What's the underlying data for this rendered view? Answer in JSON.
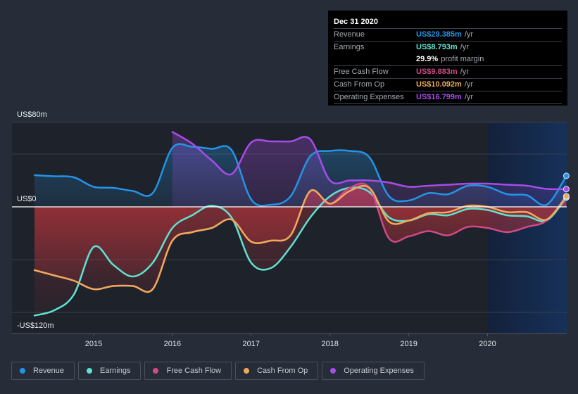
{
  "tooltip": {
    "date": "Dec 31 2020",
    "rows": [
      {
        "label": "Revenue",
        "value": "US$29.385m",
        "unit": "/yr",
        "color": "#2394e6"
      },
      {
        "label": "Earnings",
        "value": "US$8.793m",
        "unit": "/yr",
        "color": "#5ee3d0"
      },
      {
        "label": "",
        "value": "29.9%",
        "unit": "profit margin",
        "color": "#ffffff"
      },
      {
        "label": "Free Cash Flow",
        "value": "US$9.883m",
        "unit": "/yr",
        "color": "#d14987"
      },
      {
        "label": "Cash From Op",
        "value": "US$10.092m",
        "unit": "/yr",
        "color": "#eeaa5a"
      },
      {
        "label": "Operating Expenses",
        "value": "US$16.799m",
        "unit": "/yr",
        "color": "#a64de8"
      }
    ]
  },
  "legend": [
    {
      "label": "Revenue",
      "color": "#2394e6"
    },
    {
      "label": "Earnings",
      "color": "#5ee3d0"
    },
    {
      "label": "Free Cash Flow",
      "color": "#d14987"
    },
    {
      "label": "Cash From Op",
      "color": "#eeaa5a"
    },
    {
      "label": "Operating Expenses",
      "color": "#a64de8"
    }
  ],
  "chart_data": {
    "type": "line",
    "title": "",
    "xlabel": "",
    "ylabel": "",
    "ylim": [
      -120,
      80
    ],
    "y_unit": "US$m",
    "y_tick_labels": [
      {
        "value": 80,
        "label": "US$80m"
      },
      {
        "value": 0,
        "label": "US$0"
      },
      {
        "value": -120,
        "label": "-US$120m"
      }
    ],
    "gridlines": [
      80,
      50,
      0,
      -50,
      -100
    ],
    "x_range": [
      2014.25,
      2021.0
    ],
    "x_ticks": [
      2015,
      2016,
      2017,
      2018,
      2019,
      2020
    ],
    "forecast_start": 2020.0,
    "grid": true,
    "legend_position": "bottom-left",
    "series": [
      {
        "name": "Revenue",
        "color": "#2394e6",
        "points": [
          [
            2014.25,
            30
          ],
          [
            2014.5,
            29
          ],
          [
            2014.75,
            28
          ],
          [
            2015.0,
            19
          ],
          [
            2015.25,
            18
          ],
          [
            2015.5,
            15
          ],
          [
            2015.75,
            13
          ],
          [
            2016.0,
            56
          ],
          [
            2016.25,
            57
          ],
          [
            2016.5,
            55
          ],
          [
            2016.75,
            54
          ],
          [
            2017.0,
            7
          ],
          [
            2017.25,
            2
          ],
          [
            2017.5,
            10
          ],
          [
            2017.75,
            48
          ],
          [
            2018.0,
            53
          ],
          [
            2018.25,
            53
          ],
          [
            2018.5,
            47
          ],
          [
            2018.75,
            10
          ],
          [
            2019.0,
            6
          ],
          [
            2019.25,
            13
          ],
          [
            2019.5,
            12
          ],
          [
            2019.75,
            20
          ],
          [
            2020.0,
            19
          ],
          [
            2020.25,
            12
          ],
          [
            2020.5,
            11
          ],
          [
            2020.75,
            2
          ],
          [
            2021.0,
            29.385
          ]
        ]
      },
      {
        "name": "Earnings",
        "color": "#5ee3d0",
        "points": [
          [
            2014.25,
            -103
          ],
          [
            2014.5,
            -98
          ],
          [
            2014.75,
            -83
          ],
          [
            2015.0,
            -38
          ],
          [
            2015.25,
            -55
          ],
          [
            2015.5,
            -66
          ],
          [
            2015.75,
            -53
          ],
          [
            2016.0,
            -20
          ],
          [
            2016.25,
            -8
          ],
          [
            2016.5,
            1
          ],
          [
            2016.75,
            -10
          ],
          [
            2017.0,
            -53
          ],
          [
            2017.25,
            -58
          ],
          [
            2017.5,
            -38
          ],
          [
            2017.75,
            -10
          ],
          [
            2018.0,
            10
          ],
          [
            2018.25,
            18
          ],
          [
            2018.5,
            14
          ],
          [
            2018.75,
            -10
          ],
          [
            2019.0,
            -13
          ],
          [
            2019.25,
            -7
          ],
          [
            2019.5,
            -8
          ],
          [
            2019.75,
            -2
          ],
          [
            2020.0,
            -3
          ],
          [
            2020.25,
            -8
          ],
          [
            2020.5,
            -9
          ],
          [
            2020.75,
            -13
          ],
          [
            2021.0,
            8.793
          ]
        ]
      },
      {
        "name": "Free Cash Flow",
        "color": "#d14987",
        "points": [
          [
            2014.25,
            -60
          ],
          [
            2014.5,
            -65
          ],
          [
            2014.75,
            -70
          ],
          [
            2015.0,
            -78
          ],
          [
            2015.25,
            -75
          ],
          [
            2015.5,
            -75
          ],
          [
            2015.75,
            -78
          ],
          [
            2016.0,
            -32
          ],
          [
            2016.25,
            -24
          ],
          [
            2016.5,
            -20
          ],
          [
            2016.75,
            -12
          ],
          [
            2017.0,
            -33
          ],
          [
            2017.25,
            -32
          ],
          [
            2017.5,
            -27
          ],
          [
            2017.75,
            15
          ],
          [
            2018.0,
            3
          ],
          [
            2018.25,
            18
          ],
          [
            2018.5,
            18
          ],
          [
            2018.75,
            -30
          ],
          [
            2019.0,
            -28
          ],
          [
            2019.25,
            -23
          ],
          [
            2019.5,
            -27
          ],
          [
            2019.75,
            -19
          ],
          [
            2020.0,
            -20
          ],
          [
            2020.25,
            -24
          ],
          [
            2020.5,
            -19
          ],
          [
            2020.75,
            -13
          ],
          [
            2021.0,
            9.883
          ]
        ]
      },
      {
        "name": "Cash From Op",
        "color": "#eeaa5a",
        "points": [
          [
            2014.25,
            -60
          ],
          [
            2014.5,
            -65
          ],
          [
            2014.75,
            -70
          ],
          [
            2015.0,
            -78
          ],
          [
            2015.25,
            -75
          ],
          [
            2015.5,
            -75
          ],
          [
            2015.75,
            -78
          ],
          [
            2016.0,
            -32
          ],
          [
            2016.25,
            -24
          ],
          [
            2016.5,
            -20
          ],
          [
            2016.75,
            -12
          ],
          [
            2017.0,
            -33
          ],
          [
            2017.25,
            -32
          ],
          [
            2017.5,
            -27
          ],
          [
            2017.75,
            15
          ],
          [
            2018.0,
            3
          ],
          [
            2018.25,
            15
          ],
          [
            2018.5,
            18
          ],
          [
            2018.75,
            -14
          ],
          [
            2019.0,
            -13
          ],
          [
            2019.25,
            -6
          ],
          [
            2019.5,
            -5
          ],
          [
            2019.75,
            1
          ],
          [
            2020.0,
            0
          ],
          [
            2020.25,
            -5
          ],
          [
            2020.5,
            -5
          ],
          [
            2020.75,
            -12
          ],
          [
            2021.0,
            10.092
          ]
        ]
      },
      {
        "name": "Operating Expenses",
        "color": "#a64de8",
        "points": [
          [
            2016.0,
            71
          ],
          [
            2016.25,
            60
          ],
          [
            2016.5,
            44
          ],
          [
            2016.75,
            31
          ],
          [
            2017.0,
            61
          ],
          [
            2017.25,
            62
          ],
          [
            2017.5,
            62
          ],
          [
            2017.75,
            64
          ],
          [
            2018.0,
            25
          ],
          [
            2018.25,
            25
          ],
          [
            2018.5,
            25
          ],
          [
            2018.75,
            23
          ],
          [
            2019.0,
            19
          ],
          [
            2019.25,
            20
          ],
          [
            2019.5,
            21
          ],
          [
            2019.75,
            22
          ],
          [
            2020.0,
            22
          ],
          [
            2020.25,
            21
          ],
          [
            2020.5,
            20
          ],
          [
            2020.75,
            17
          ],
          [
            2021.0,
            16.799
          ]
        ]
      }
    ]
  }
}
